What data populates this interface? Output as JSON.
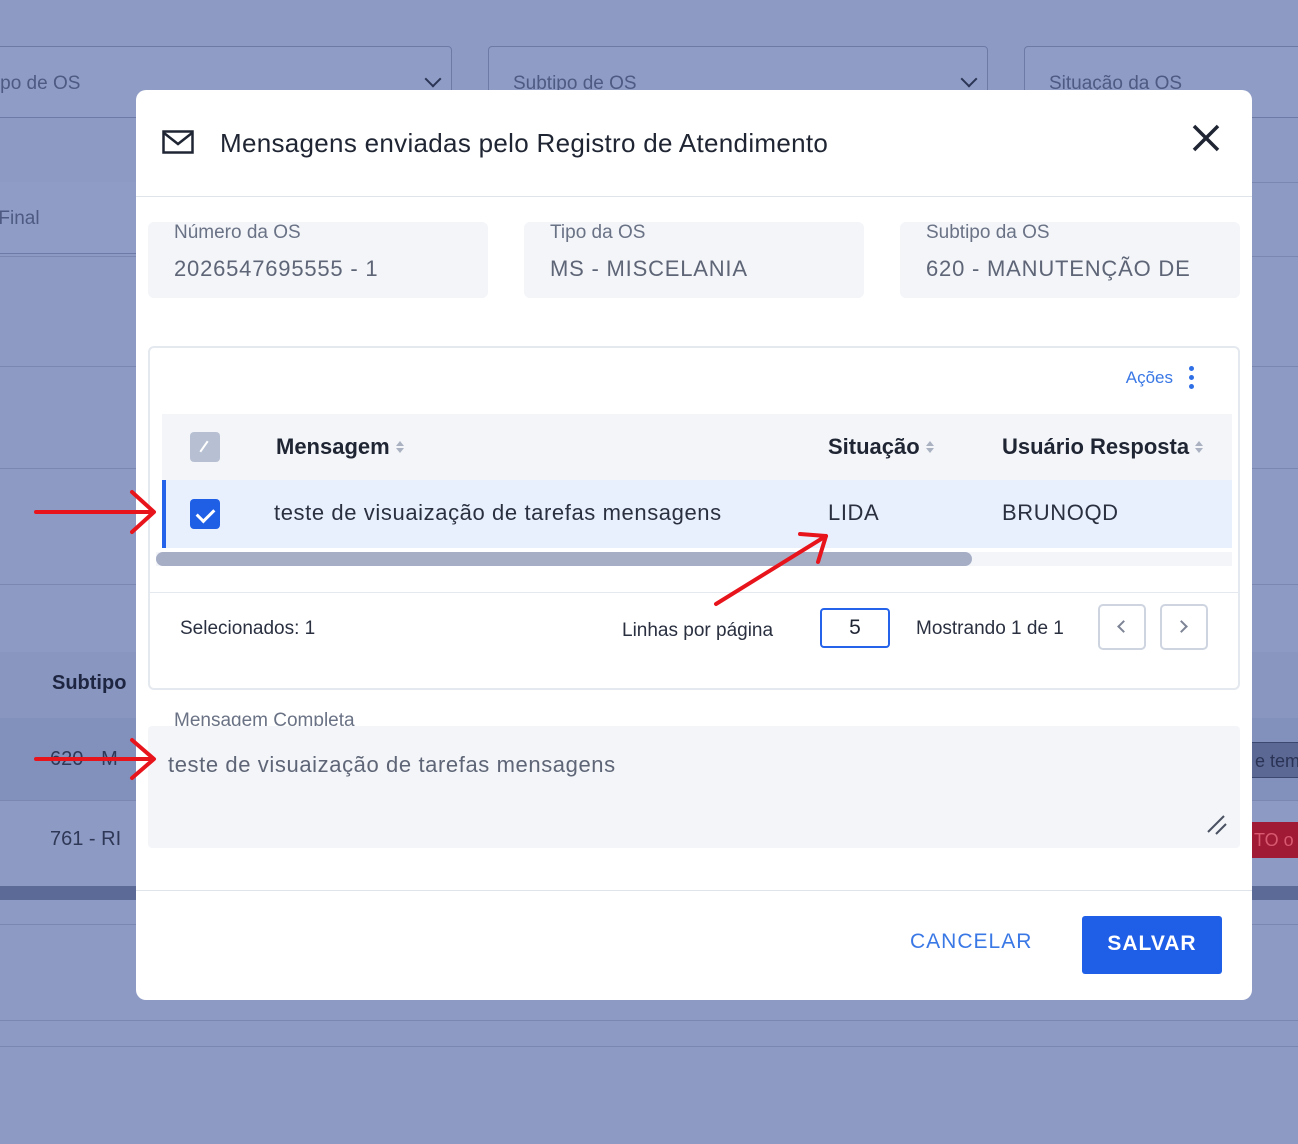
{
  "background": {
    "filters": [
      "Tipo de OS",
      "Subtipo de OS",
      "Situação da OS"
    ],
    "date_label": "Data Final",
    "table_header": "Subtipo",
    "rows": [
      "620 - M",
      "761 - RI"
    ],
    "pills": [
      "e tem",
      "TO o"
    ]
  },
  "modal": {
    "icon": "mail-icon",
    "title": "Mensagens enviadas pelo Registro de Atendimento",
    "close_icon": "close-icon",
    "info": [
      {
        "label": "Número da OS",
        "value": "2026547695555 - 1"
      },
      {
        "label": "Tipo da OS",
        "value": "MS - MISCELANIA"
      },
      {
        "label": "Subtipo da OS",
        "value": "620 -  MANUTENÇÃO DE"
      }
    ],
    "table": {
      "actions_label": "Ações",
      "columns": [
        "Mensagem",
        "Situação",
        "Usuário Resposta"
      ],
      "rows": [
        {
          "selected": true,
          "mensagem": "teste de visuaização de tarefas mensagens",
          "situacao": "LIDA",
          "usuario": "BRUNOQD"
        }
      ],
      "selected_count": "Selecionados: 1",
      "rows_per_page_label": "Linhas por página",
      "rows_per_page": "5",
      "showing": "Mostrando 1 de 1"
    },
    "full_message_label": "Mensagem Completa",
    "full_message": "teste de visuaização de tarefas mensagens",
    "cancel_label": "CANCELAR",
    "save_label": "SALVAR"
  },
  "colors": {
    "accent": "#1f5fe8",
    "annotation": "#e8141c",
    "overlay": "#8d9ac4"
  }
}
